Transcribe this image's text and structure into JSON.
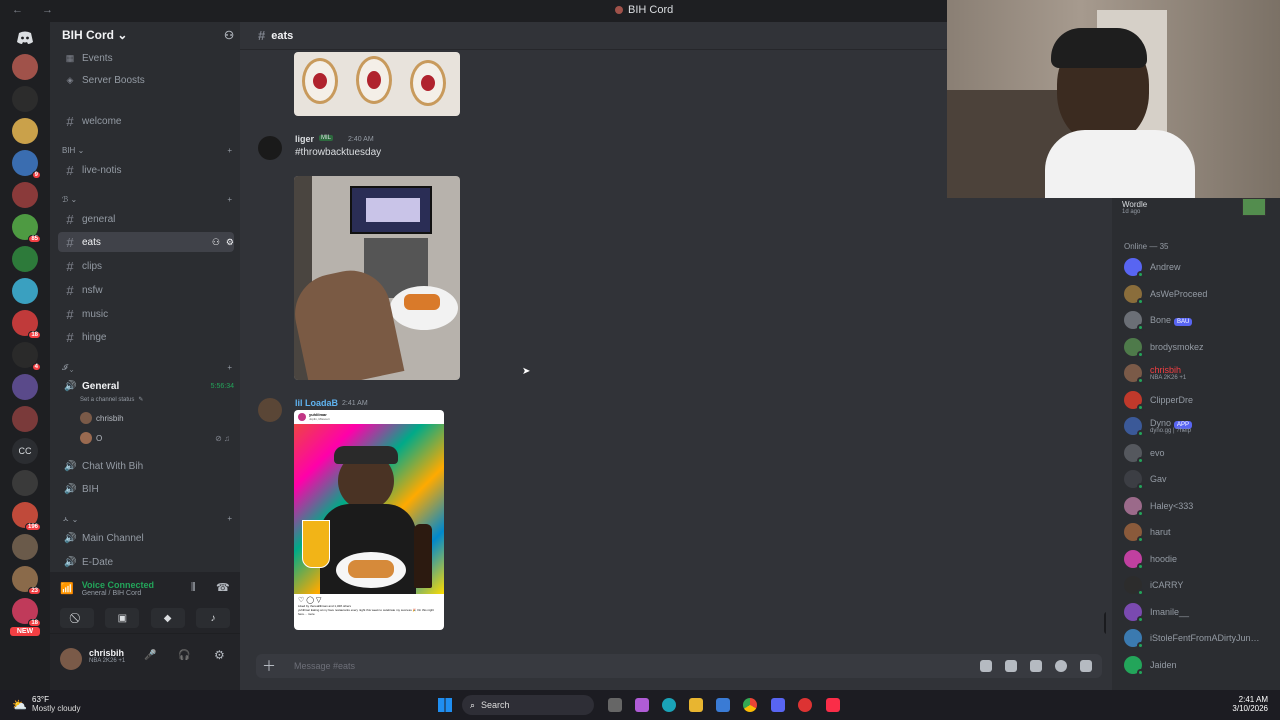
{
  "window": {
    "title": "BIH Cord",
    "nav": "← →"
  },
  "servers": {
    "badges": [
      "",
      "",
      "",
      "",
      "9",
      "",
      "85",
      "",
      "",
      "18",
      "4",
      "",
      "",
      "",
      "196",
      "",
      "23",
      "18",
      "26"
    ],
    "cc_label": "CC",
    "new_label": "NEW"
  },
  "sidebar": {
    "server_name": "BIH Cord",
    "items": [
      {
        "label": "Events",
        "kind": "event"
      },
      {
        "label": "Server Boosts",
        "kind": "boost"
      },
      {
        "label": "welcome",
        "kind": "text"
      }
    ],
    "categories": [
      {
        "label": "BIH"
      },
      {
        "label": "ℬ"
      },
      {
        "label": "𝓘"
      },
      {
        "label": "ㅅ"
      }
    ],
    "channels": {
      "live": "live-notis",
      "general": "general",
      "eats": "eats",
      "clips": "clips",
      "nsfw": "nsfw",
      "music": "music",
      "hinge": "hinge"
    },
    "voice": {
      "general": "General",
      "general_time": "5:56:34",
      "channel_status": "Set a channel status",
      "user1": "chrisbih",
      "user2": "O",
      "chat_with_bih": "Chat With Bih",
      "bih": "BIH",
      "main_channel": "Main Channel",
      "edate": "E-Date"
    },
    "voice_connected": {
      "title": "Voice Connected",
      "sub": "General / BIH Cord"
    },
    "user": {
      "name": "chrisbih",
      "status": "NBA 2K26 +1"
    }
  },
  "channel_header": {
    "name": "eats"
  },
  "messages": [
    {
      "author": "liger",
      "badge": "MIL",
      "time": "2:40 AM",
      "text": "#throwbacktuesday",
      "name_color": "#dbdee1"
    },
    {
      "author": "lil LoadaB",
      "time": "2:41 AM",
      "name_color": "#5fb3f0"
    }
  ],
  "embed": {
    "handle": "yuhlilmar",
    "location": "Joplin, Missouri",
    "caption": "yuhlilmar Eating at my fave restaurants every night this week to celebrate my success 🎉 On this night here… more",
    "likes": "Liked by therealliliman and 1,328 others"
  },
  "composer": {
    "placeholder": "Message #eats"
  },
  "members": {
    "activity_title": "Wordle",
    "activity_sub": "1d ago",
    "online_header": "Online — 35",
    "list": [
      {
        "name": "Andrew",
        "color": "#5865f2"
      },
      {
        "name": "AsWeProceed",
        "color": "#8a6d3b"
      },
      {
        "name": "Bone",
        "tag": "BAU",
        "color": "#6b6f76"
      },
      {
        "name": "brodysmokez",
        "color": "#4e7a4a"
      },
      {
        "name": "chrisbih",
        "sub": "NBA 2K26 +1",
        "color": "#7a5a48",
        "name_color": "#f23f43"
      },
      {
        "name": "ClipperDre",
        "color": "#c0392b"
      },
      {
        "name": "Dyno",
        "tag": "APP",
        "sub": "dyno.gg | ?help",
        "color": "#3b5998"
      },
      {
        "name": "evo",
        "color": "#55585e"
      },
      {
        "name": "Gav",
        "color": "#3c3e44"
      },
      {
        "name": "Haley<333",
        "color": "#9b6a8a"
      },
      {
        "name": "harut",
        "color": "#8a5a3b"
      },
      {
        "name": "hoodie",
        "color": "#c040a0"
      },
      {
        "name": "iCARRY",
        "color": "#2c2c2c"
      },
      {
        "name": "Imanile__",
        "color": "#7a4ab0"
      },
      {
        "name": "iStoleFentFromADirtyJun…",
        "color": "#3b7ab0"
      },
      {
        "name": "Jaiden",
        "color": "#23a55a"
      }
    ]
  },
  "taskbar": {
    "weather_temp": "63°F",
    "weather_desc": "Mostly cloudy",
    "search": "Search",
    "time": "2:41 AM",
    "date": "3/10/2026"
  },
  "colors": {
    "accent": "#5865f2",
    "online": "#23a55a",
    "bg": "#313338",
    "sidebar": "#2b2d31"
  }
}
